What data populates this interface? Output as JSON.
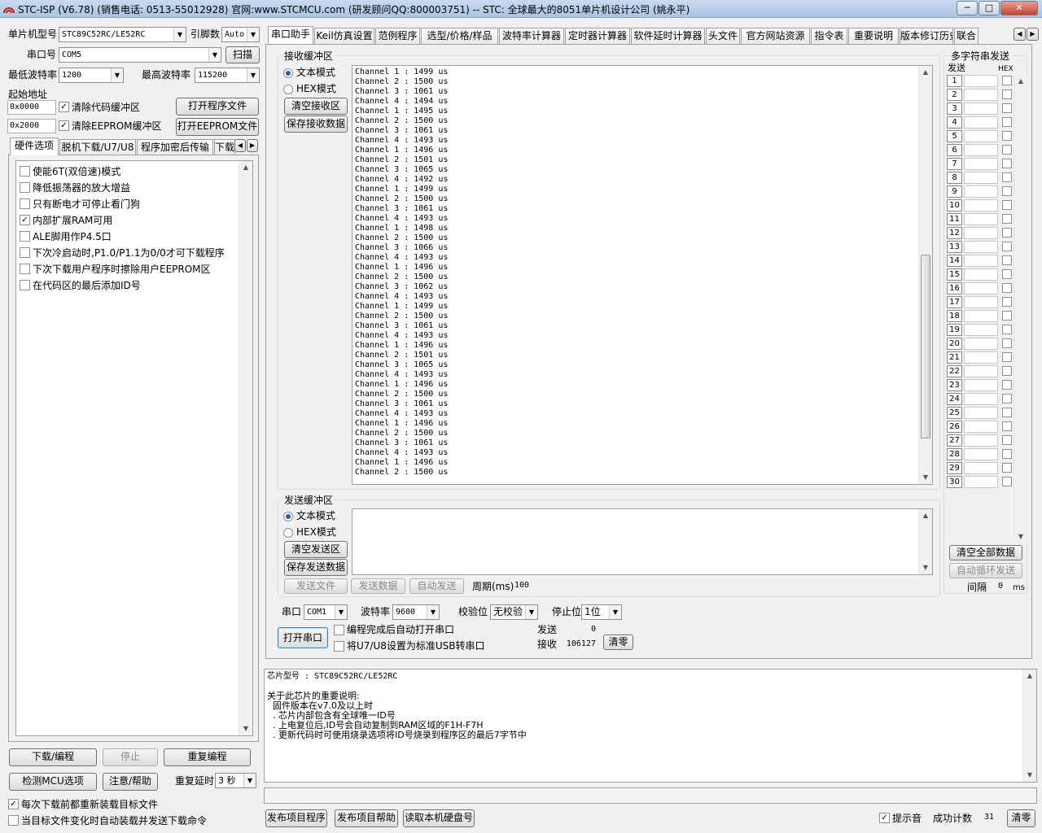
{
  "window": {
    "title": "STC-ISP (V6.78) (销售电话: 0513-55012928) 官网:www.STCMCU.com  (研发顾问QQ:800003751)  -- STC: 全球最大的8051单片机设计公司 (姚永平)",
    "min": "─",
    "max": "□",
    "close": "✕"
  },
  "left": {
    "mcu_label": "单片机型号",
    "mcu_value": "STC89C52RC/LE52RC",
    "pins_label": "引脚数",
    "pins_value": "Auto",
    "port_label": "串口号",
    "port_value": "COM5",
    "scan_btn": "扫描",
    "min_baud_label": "最低波特率",
    "min_baud_value": "1200",
    "max_baud_label": "最高波特率",
    "max_baud_value": "115200",
    "start_addr_label": "起始地址",
    "addr1": "0x0000",
    "clear_code_label": "清除代码缓冲区",
    "open_prog_btn": "打开程序文件",
    "addr2": "0x2000",
    "clear_eeprom_label": "清除EEPROM缓冲区",
    "open_eeprom_btn": "打开EEPROM文件",
    "tabs": [
      "硬件选项",
      "脱机下载/U7/U8",
      "程序加密后传输",
      "下载"
    ],
    "options": [
      {
        "label": "使能6T(双倍速)模式",
        "checked": false
      },
      {
        "label": "降低振荡器的放大增益",
        "checked": false
      },
      {
        "label": "只有断电才可停止看门狗",
        "checked": false
      },
      {
        "label": "内部扩展RAM可用",
        "checked": true
      },
      {
        "label": "ALE脚用作P4.5口",
        "checked": false
      },
      {
        "label": "下次冷启动时,P1.0/P1.1为0/0才可下载程序",
        "checked": false
      },
      {
        "label": "下次下载用户程序时擦除用户EEPROM区",
        "checked": false
      },
      {
        "label": "在代码区的最后添加ID号",
        "checked": false
      }
    ],
    "download_btn": "下载/编程",
    "stop_btn": "停止",
    "reprogram_btn": "重复编程",
    "check_mcu_btn": "检测MCU选项",
    "help_btn": "注意/帮助",
    "repeat_delay_label": "重复延时",
    "repeat_delay_value": "3 秒",
    "reload_label": "每次下载前都重新装载目标文件",
    "auto_reload_label": "当目标文件变化时自动装载并发送下载命令"
  },
  "right_tabs": [
    "串口助手",
    "Keil仿真设置",
    "范例程序",
    "选型/价格/样品",
    "波特率计算器",
    "定时器计算器",
    "软件延时计算器",
    "头文件",
    "官方网站资源",
    "指令表",
    "重要说明",
    "版本修订历史",
    "联合"
  ],
  "receive": {
    "group_label": "接收缓冲区",
    "text_mode": "文本模式",
    "hex_mode": "HEX模式",
    "clear_btn": "清空接收区",
    "save_btn": "保存接收数据",
    "lines": [
      "Channel 1 : 1499 us",
      "Channel 2 : 1500 us",
      "Channel 3 : 1061 us",
      "Channel 4 : 1494 us",
      "Channel 1 : 1495 us",
      "Channel 2 : 1500 us",
      "Channel 3 : 1061 us",
      "Channel 4 : 1493 us",
      "Channel 1 : 1496 us",
      "Channel 2 : 1501 us",
      "Channel 3 : 1065 us",
      "Channel 4 : 1492 us",
      "Channel 1 : 1499 us",
      "Channel 2 : 1500 us",
      "Channel 3 : 1061 us",
      "Channel 4 : 1493 us",
      "Channel 1 : 1498 us",
      "Channel 2 : 1500 us",
      "Channel 3 : 1066 us",
      "Channel 4 : 1493 us",
      "Channel 1 : 1496 us",
      "Channel 2 : 1500 us",
      "Channel 3 : 1062 us",
      "Channel 4 : 1493 us",
      "Channel 1 : 1499 us",
      "Channel 2 : 1500 us",
      "Channel 3 : 1061 us",
      "Channel 4 : 1493 us",
      "Channel 1 : 1496 us",
      "Channel 2 : 1501 us",
      "Channel 3 : 1065 us",
      "Channel 4 : 1493 us",
      "Channel 1 : 1496 us",
      "Channel 2 : 1500 us",
      "Channel 3 : 1061 us",
      "Channel 4 : 1493 us",
      "Channel 1 : 1496 us",
      "Channel 2 : 1500 us",
      "Channel 3 : 1061 us",
      "Channel 4 : 1493 us",
      "Channel 1 : 1496 us",
      "Channel 2 : 1500 us"
    ]
  },
  "send": {
    "group_label": "发送缓冲区",
    "text_mode": "文本模式",
    "hex_mode": "HEX模式",
    "clear_btn": "清空发送区",
    "save_btn": "保存发送数据",
    "send_file_btn": "发送文件",
    "send_data_btn": "发送数据",
    "auto_send_btn": "自动发送",
    "period_label": "周期(ms)",
    "period_value": "100"
  },
  "serial": {
    "port_label": "串口",
    "port_value": "COM1",
    "baud_label": "波特率",
    "baud_value": "9600",
    "parity_label": "校验位",
    "parity_value": "无校验",
    "stop_label": "停止位",
    "stop_value": "1位",
    "open_btn": "打开串口",
    "auto_open_label": "编程完成后自动打开串口",
    "usb_label": "将U7/U8设置为标准USB转串口",
    "send_label": "发送",
    "send_count": "0",
    "recv_label": "接收",
    "recv_count": "106127",
    "clear_btn": "清零"
  },
  "multi": {
    "title": "多字符串发送",
    "send_col": "发送",
    "hex_col": "HEX",
    "rows": [
      "1",
      "2",
      "3",
      "4",
      "5",
      "6",
      "7",
      "8",
      "9",
      "10",
      "11",
      "12",
      "13",
      "14",
      "15",
      "16",
      "17",
      "18",
      "19",
      "20",
      "21",
      "22",
      "23",
      "24",
      "25",
      "26",
      "27",
      "28",
      "29",
      "30"
    ],
    "clear_all_btn": "清空全部数据",
    "auto_loop_btn": "自动循环发送",
    "interval_label": "间隔",
    "interval_value": "0",
    "interval_unit": "ms"
  },
  "info": {
    "lines": [
      "芯片型号 : STC89C52RC/LE52RC",
      "",
      "关于此芯片的重要说明:",
      "  固件版本在v7.0及以上时",
      "  . 芯片内部包含有全球唯一ID号",
      "  . 上电复位后,ID号会自动复制到RAM区域的F1H-F7H",
      "  . 更新代码时可使用烧录选项将ID号烧录到程序区的最后7字节中"
    ]
  },
  "bottom": {
    "publish_prog_btn": "发布项目程序",
    "publish_help_btn": "发布项目帮助",
    "read_disk_btn": "读取本机硬盘号",
    "sound_label": "提示音",
    "success_label": "成功计数",
    "success_value": "31",
    "clear_btn": "清零"
  }
}
